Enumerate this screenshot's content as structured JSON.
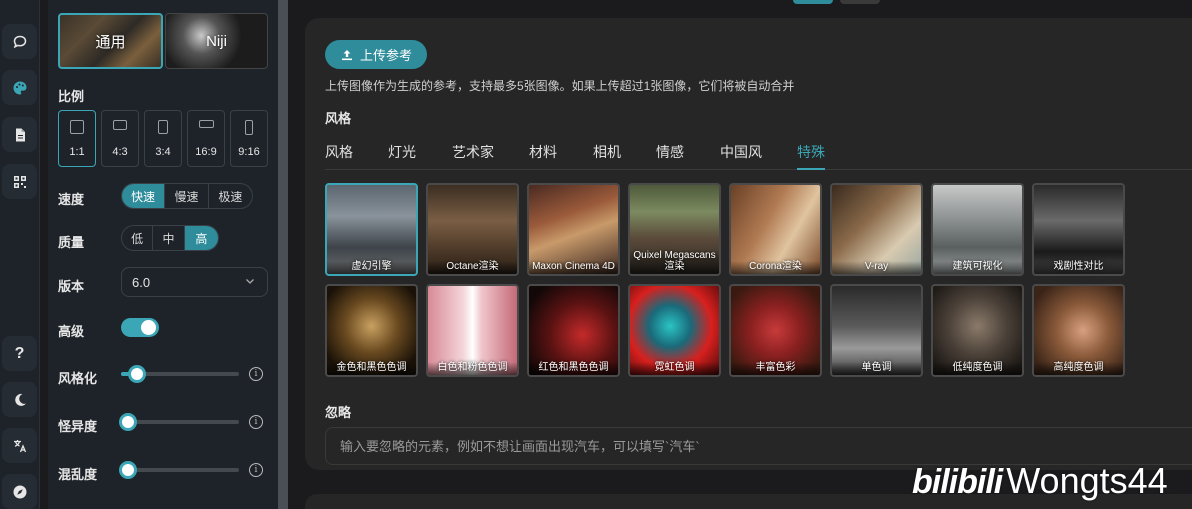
{
  "rail": {
    "items_top": [
      "chat-icon",
      "palette-icon",
      "document-icon",
      "qr-code-icon"
    ],
    "items_bottom": [
      "help-icon",
      "moon-icon",
      "translate-icon",
      "compass-icon"
    ],
    "help_glyph": "?"
  },
  "panel": {
    "models": [
      {
        "label": "通用",
        "selected": true
      },
      {
        "label": "Niji",
        "selected": false
      }
    ],
    "ratio_label": "比例",
    "ratios": [
      {
        "label": "1:1",
        "selected": true
      },
      {
        "label": "4:3",
        "selected": false
      },
      {
        "label": "3:4",
        "selected": false
      },
      {
        "label": "16:9",
        "selected": false
      },
      {
        "label": "9:16",
        "selected": false
      }
    ],
    "speed_label": "速度",
    "speed_options": [
      {
        "label": "快速",
        "selected": true
      },
      {
        "label": "慢速",
        "selected": false
      },
      {
        "label": "极速",
        "selected": false
      }
    ],
    "quality_label": "质量",
    "quality_options": [
      {
        "label": "低",
        "selected": false
      },
      {
        "label": "中",
        "selected": false
      },
      {
        "label": "高",
        "selected": true
      }
    ],
    "version_label": "版本",
    "version_value": "6.0",
    "advanced_label": "高级",
    "advanced_enabled": true,
    "stylize_label": "风格化",
    "stylize_fraction": 0.08,
    "weird_label": "怪异度",
    "weird_fraction": 0.0,
    "chaos_label": "混乱度",
    "chaos_fraction": 0.0,
    "info_glyph": "i"
  },
  "main": {
    "upload_button": "上传参考",
    "upload_hint": "上传图像作为生成的参考，支持最多5张图像。如果上传超过1张图像，它们将被自动合并",
    "style_heading": "风格",
    "tabs": [
      {
        "label": "风格",
        "active": false
      },
      {
        "label": "灯光",
        "active": false
      },
      {
        "label": "艺术家",
        "active": false
      },
      {
        "label": "材料",
        "active": false
      },
      {
        "label": "相机",
        "active": false
      },
      {
        "label": "情感",
        "active": false
      },
      {
        "label": "中国风",
        "active": false
      },
      {
        "label": "特殊",
        "active": true
      }
    ],
    "styles": [
      {
        "caption": "虚幻引擎",
        "selected": true
      },
      {
        "caption": "Octane渲染",
        "selected": false
      },
      {
        "caption": "Maxon Cinema 4D",
        "selected": false
      },
      {
        "caption": "Quixel Megascans渲染",
        "selected": false
      },
      {
        "caption": "Corona渲染",
        "selected": false
      },
      {
        "caption": "V-ray",
        "selected": false
      },
      {
        "caption": "建筑可视化",
        "selected": false
      },
      {
        "caption": "戏剧性对比",
        "selected": false
      },
      {
        "caption": "金色和黑色色调",
        "selected": false
      },
      {
        "caption": "白色和粉色色调",
        "selected": false
      },
      {
        "caption": "红色和黑色色调",
        "selected": false
      },
      {
        "caption": "霓虹色调",
        "selected": false
      },
      {
        "caption": "丰富色彩",
        "selected": false
      },
      {
        "caption": "单色调",
        "selected": false
      },
      {
        "caption": "低纯度色调",
        "selected": false
      },
      {
        "caption": "高纯度色调",
        "selected": false
      }
    ],
    "ignore_heading": "忽略",
    "ignore_placeholder": "输入要忽略的元素，例如不想让画面出现汽车，可以填写`汽车`"
  },
  "watermark": {
    "logo": "bilibili",
    "user": "Wongts44"
  },
  "colors": {
    "accent": "#3ba6b5",
    "panel_bg": "#1e2329",
    "card_bg": "#262626",
    "page_bg": "#1b1b1d"
  }
}
